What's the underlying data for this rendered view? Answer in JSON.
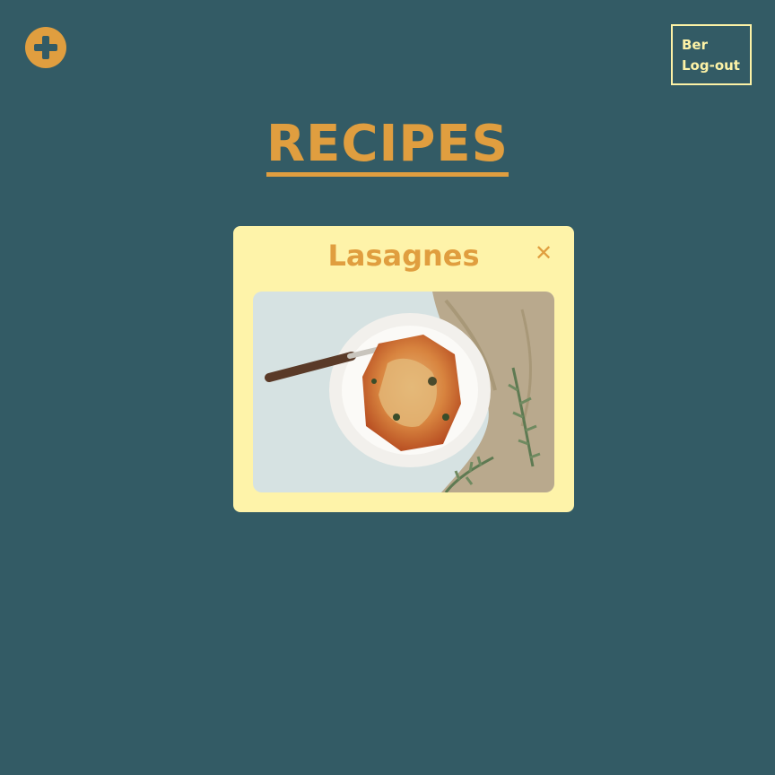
{
  "header": {
    "add_icon": "plus-circle-icon",
    "user_name": "Ber",
    "logout_label": "Log-out"
  },
  "main": {
    "title": "RECIPES"
  },
  "recipes": [
    {
      "title": "Lasagnes",
      "close_icon": "close-icon"
    }
  ],
  "colors": {
    "background": "#335b65",
    "accent": "#e09e3f",
    "card": "#fef3a9",
    "user_text": "#fdf2a6"
  }
}
